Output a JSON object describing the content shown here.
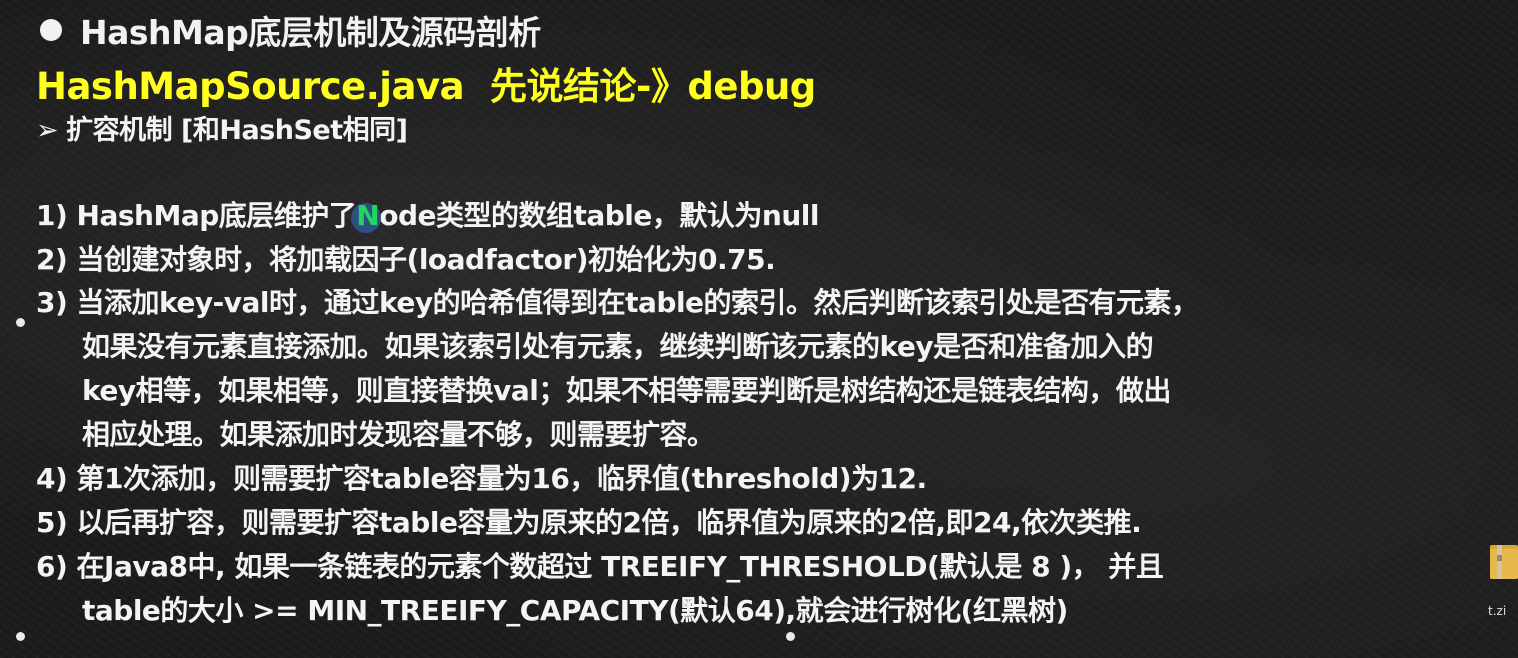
{
  "slide": {
    "title": "HashMap底层机制及源码剖析",
    "subtitle_file": "HashMapSource.java",
    "subtitle_note": "先说结论-》debug",
    "section_heading": "扩容机制 [和HashSet相同]",
    "arrow_symbol": "➢",
    "items": [
      {
        "num": "1)",
        "pre": "HashMap底层维护了",
        "highlight": "N",
        "post": "ode类型的数组table，默认为null"
      },
      {
        "num": "2)",
        "text": "当创建对象时，将加载因子(loadfactor)初始化为0.75."
      },
      {
        "num": "3)",
        "text": "当添加key-val时，通过key的哈希值得到在table的索引。然后判断该索引处是否有元素，",
        "cont": [
          "如果没有元素直接添加。如果该索引处有元素，继续判断该元素的key是否和准备加入的",
          "key相等，如果相等，则直接替换val；如果不相等需要判断是树结构还是链表结构，做出",
          "相应处理。如果添加时发现容量不够，则需要扩容。"
        ]
      },
      {
        "num": "4)",
        "text": "第1次添加，则需要扩容table容量为16，临界值(threshold)为12."
      },
      {
        "num": "5)",
        "text": "以后再扩容，则需要扩容table容量为原来的2倍，临界值为原来的2倍,即24,依次类推."
      },
      {
        "num": "6)",
        "text": "在Java8中, 如果一条链表的元素个数超过 TREEIFY_THRESHOLD(默认是 8 )，  并且",
        "cont": [
          "table的大小 >= MIN_TREEIFY_CAPACITY(默认64),就会进行树化(红黑树)"
        ]
      }
    ]
  },
  "desktop": {
    "folder_label": "t.zi",
    "folder_color": "#e7b84a"
  },
  "colors": {
    "background": "#1b1b1b",
    "text": "#f4f4f4",
    "highlight_yellow": "#ffff1f",
    "cursor_green": "#23d463",
    "cursor_blue": "#2e4f82"
  }
}
